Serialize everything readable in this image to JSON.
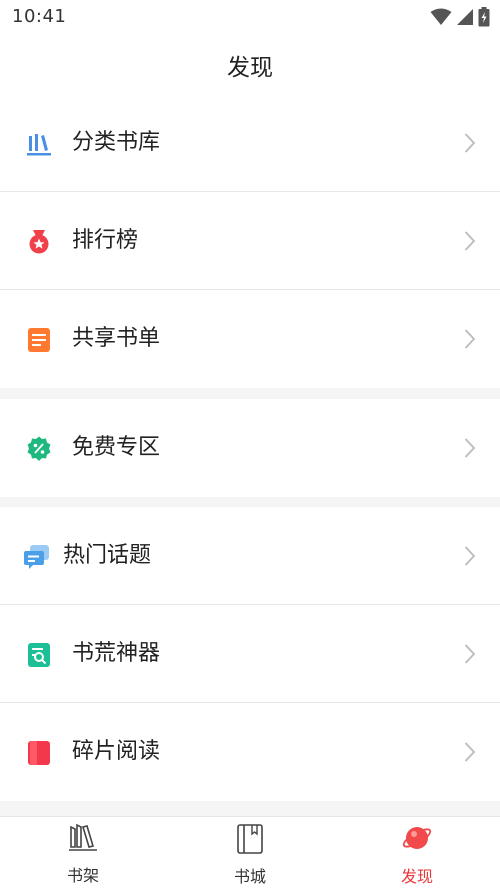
{
  "status_bar": {
    "time": "10:41",
    "icons": [
      "wifi-icon",
      "signal-icon",
      "battery-icon"
    ]
  },
  "header": {
    "title": "发现"
  },
  "groups": [
    {
      "items": [
        {
          "label": "分类书库",
          "icon": "library-icon",
          "color": "#4a90e2"
        },
        {
          "label": "排行榜",
          "icon": "medal-icon",
          "color": "#f0404a"
        },
        {
          "label": "共享书单",
          "icon": "booklist-icon",
          "color": "#ff7a30"
        }
      ]
    },
    {
      "items": [
        {
          "label": "免费专区",
          "icon": "free-badge-icon",
          "color": "#1fb87f"
        }
      ]
    },
    {
      "items": [
        {
          "label": "热门话题",
          "icon": "chat-icon",
          "color": "#4a9fe8"
        },
        {
          "label": "书荒神器",
          "icon": "book-search-icon",
          "color": "#1dbf96"
        },
        {
          "label": "碎片阅读",
          "icon": "red-book-icon",
          "color": "#f2384a"
        }
      ]
    }
  ],
  "tab_bar": {
    "tabs": [
      {
        "label": "书架",
        "icon": "bookshelf-icon",
        "active": false
      },
      {
        "label": "书城",
        "icon": "book-icon",
        "active": false
      },
      {
        "label": "发现",
        "icon": "planet-icon",
        "active": true
      }
    ],
    "active_color": "#e8383d"
  }
}
